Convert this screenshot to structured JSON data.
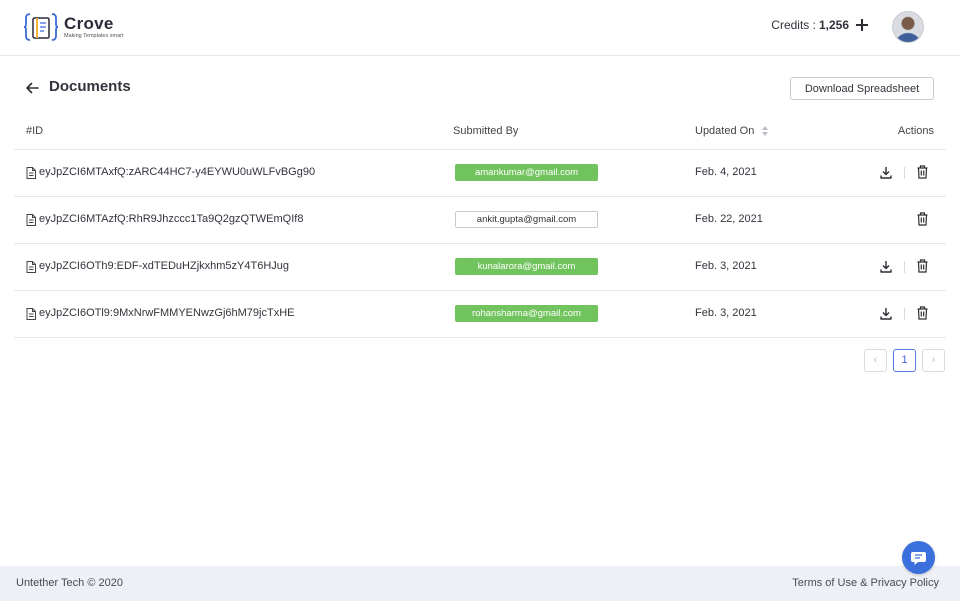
{
  "brand": {
    "name": "Crove",
    "tagline": "Making Templates smart"
  },
  "header": {
    "credits_label": "Credits :",
    "credits_value": "1,256"
  },
  "page": {
    "title": "Documents",
    "download_button": "Download Spreadsheet"
  },
  "table": {
    "headers": {
      "id": "#ID",
      "submitted_by": "Submitted By",
      "updated_on": "Updated On",
      "actions": "Actions"
    },
    "rows": [
      {
        "id": "eyJpZCI6MTAxfQ:zARC44HC7-y4EYWU0uWLFvBGg90",
        "email": "amankumar@gmail.com",
        "email_style": "filled",
        "date": "Feb. 4, 2021",
        "can_download": true
      },
      {
        "id": "eyJpZCI6MTAzfQ:RhR9Jhzccc1Ta9Q2gzQTWEmQIf8",
        "email": "ankit.gupta@gmail.com",
        "email_style": "outline",
        "date": "Feb. 22, 2021",
        "can_download": false
      },
      {
        "id": "eyJpZCI6OTh9:EDF-xdTEDuHZjkxhm5zY4T6HJug",
        "email": "kunalarora@gmail.com",
        "email_style": "filled",
        "date": "Feb. 3, 2021",
        "can_download": true
      },
      {
        "id": "eyJpZCI6OTl9:9MxNrwFMMYENwzGj6hM79jcTxHE",
        "email": "rohansharma@gmail.com",
        "email_style": "filled",
        "date": "Feb. 3, 2021",
        "can_download": true
      }
    ]
  },
  "pagination": {
    "prev": "‹",
    "current": "1",
    "next": "›"
  },
  "footer": {
    "left": "Untether Tech © 2020",
    "right": "Terms of Use & Privacy Policy"
  },
  "colors": {
    "accent": "#3b6fdb",
    "badge_green": "#71c35d",
    "footer_bg": "#edf0f6"
  },
  "icons": {
    "logo": "crove-book-logo-icon",
    "add": "plus-icon",
    "back": "arrow-left-icon",
    "sort": "sort-icon",
    "document": "document-icon",
    "download": "download-icon",
    "delete": "trash-icon",
    "chat": "chat-icon"
  }
}
